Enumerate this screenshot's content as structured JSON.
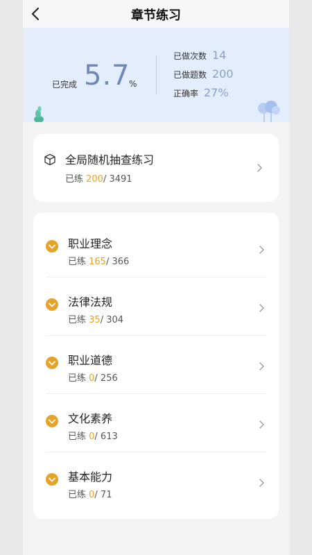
{
  "header": {
    "title": "章节练习"
  },
  "stats": {
    "completed_label": "已完成",
    "completed_value": "5.7",
    "completed_unit": "%",
    "items": [
      {
        "label": "已做次数",
        "value": "14"
      },
      {
        "label": "已做题数",
        "value": "200"
      },
      {
        "label": "正确率",
        "value": "27%"
      }
    ]
  },
  "random_practice": {
    "title": "全局随机抽查练习",
    "progress_prefix": "已练 ",
    "done": "200",
    "total_text": "/ 3491"
  },
  "chapters": [
    {
      "title": "职业理念",
      "progress_prefix": "已练 ",
      "done": "165",
      "total_text": "/ 366"
    },
    {
      "title": "法律法规",
      "progress_prefix": "已练 ",
      "done": "35",
      "total_text": "/ 304"
    },
    {
      "title": "职业道德",
      "progress_prefix": "已练 ",
      "done": "0",
      "total_text": "/ 256"
    },
    {
      "title": "文化素养",
      "progress_prefix": "已练 ",
      "done": "0",
      "total_text": "/ 613"
    },
    {
      "title": "基本能力",
      "progress_prefix": "已练 ",
      "done": "0",
      "total_text": "/ 71"
    }
  ],
  "colors": {
    "accent_orange": "#e6a32b",
    "stats_background": "#e3edfb",
    "stat_value_blue": "#6f89b5"
  }
}
